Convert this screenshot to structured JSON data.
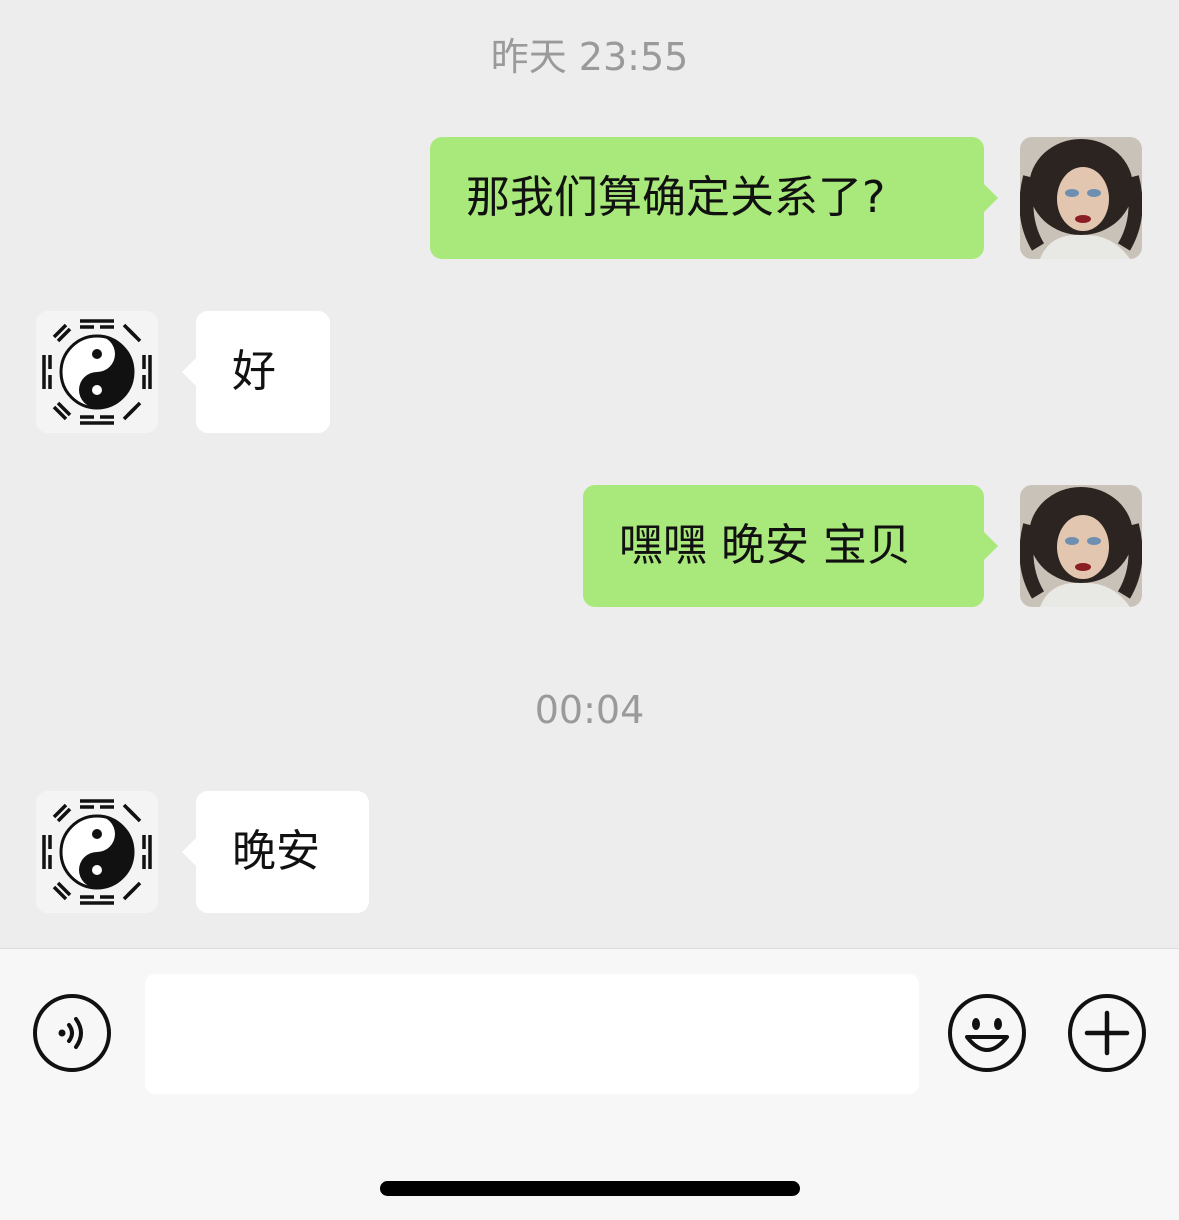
{
  "chat": {
    "timestamps": [
      "昨天 23:55",
      "00:04"
    ],
    "messages": [
      {
        "side": "sent",
        "text": "那我们算确定关系了?"
      },
      {
        "side": "received",
        "text": "好"
      },
      {
        "side": "sent",
        "text": "嘿嘿 晚安 宝贝"
      },
      {
        "side": "received",
        "text": "晚安"
      }
    ]
  },
  "input_bar": {
    "placeholder": "",
    "icons": [
      "voice-icon",
      "emoji-icon",
      "plus-icon"
    ]
  },
  "colors": {
    "background": "#ededed",
    "sent_bubble": "#a9e87a",
    "received_bubble": "#ffffff",
    "timestamp_text": "#9a9a9a"
  }
}
